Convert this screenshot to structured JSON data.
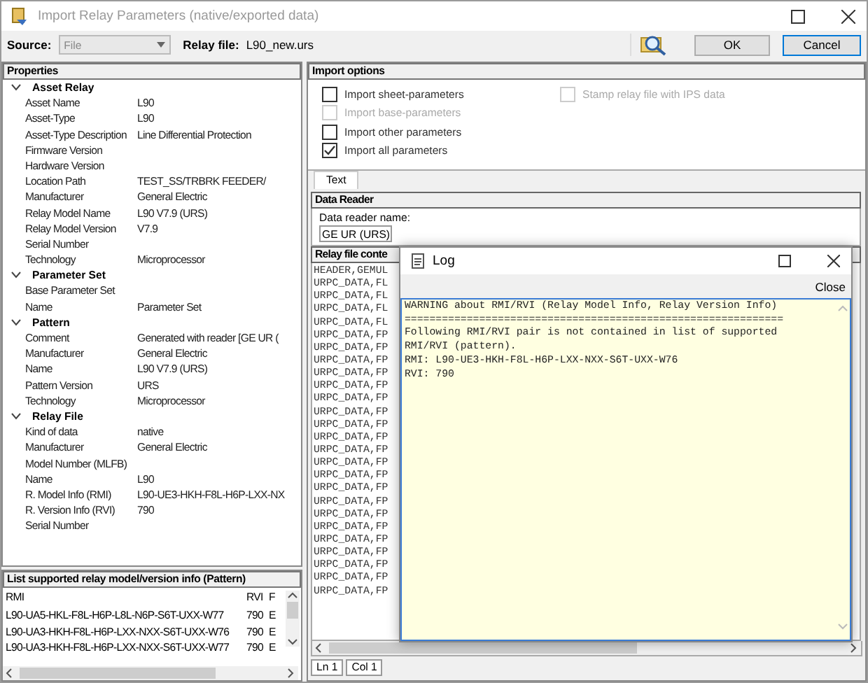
{
  "window": {
    "title": "Import Relay Parameters (native/exported data)"
  },
  "toolbar": {
    "source_label": "Source:",
    "source_value": "File",
    "relay_file_label": "Relay file:",
    "relay_file_value": "L90_new.urs",
    "buttons": [
      {
        "label": "OK",
        "selected": false
      },
      {
        "label": "Cancel",
        "selected": true
      }
    ]
  },
  "properties": {
    "title": "Properties",
    "groups": [
      {
        "name": "Asset Relay",
        "expanded": true,
        "rows": [
          {
            "name": "Asset Name",
            "value": "L90"
          },
          {
            "name": "Asset-Type",
            "value": "L90"
          },
          {
            "name": "Asset-Type Description",
            "value": "Line Differential Protection"
          },
          {
            "name": "Firmware Version"
          },
          {
            "name": "Hardware Version"
          },
          {
            "name": "Location Path",
            "value": "TEST_SS/TRBRK FEEDER/"
          },
          {
            "name": "Manufacturer",
            "value": "General Electric"
          },
          {
            "name": "Relay Model Name",
            "value": "L90   V7.9 (URS)"
          },
          {
            "name": "Relay Model Version",
            "value": "V7.9"
          },
          {
            "name": "Serial Number"
          },
          {
            "name": "Technology",
            "value": "Microprocessor"
          }
        ]
      },
      {
        "name": "Parameter Set",
        "expanded": true,
        "rows": [
          {
            "name": "Base Parameter Set"
          },
          {
            "name": "Name",
            "value": "Parameter Set"
          }
        ]
      },
      {
        "name": "Pattern",
        "expanded": true,
        "rows": [
          {
            "name": "Comment",
            "value": "Generated with reader [GE UR ("
          },
          {
            "name": "Manufacturer",
            "value": "General Electric"
          },
          {
            "name": "Name",
            "value": "L90   V7.9 (URS)"
          },
          {
            "name": "Pattern Version",
            "value": "URS"
          },
          {
            "name": "Technology",
            "value": "Microprocessor"
          }
        ]
      },
      {
        "name": "Relay File",
        "expanded": true,
        "rows": [
          {
            "name": "Kind of data",
            "value": "native"
          },
          {
            "name": "Manufacturer",
            "value": "General Electric"
          },
          {
            "name": "Model Number (MLFB)"
          },
          {
            "name": "Name",
            "value": "L90"
          },
          {
            "name": "R. Model Info (RMI)",
            "value": "L90-UE3-HKH-F8L-H6P-LXX-NX"
          },
          {
            "name": "R. Version Info (RVI)",
            "value": "790"
          },
          {
            "name": "Serial Number"
          }
        ]
      }
    ]
  },
  "pattern_list": {
    "title": "List supported relay model/version info (Pattern)",
    "columns": [
      "RMI",
      "RVI",
      "F"
    ],
    "rows": [
      [
        "L90-UA5-HKL-F8L-H6P-L8L-N6P-S6T-UXX-W77",
        "790",
        "E"
      ],
      [
        "L90-UA3-HKH-F8L-H6P-LXX-NXX-S6T-UXX-W76",
        "790",
        "E"
      ],
      [
        "L90-UA3-HKH-F8L-H6P-LXX-NXX-S6T-UXX-W77",
        "790",
        "E"
      ]
    ]
  },
  "import_options": {
    "title": "Import options",
    "options": [
      {
        "label": "Import sheet-parameters",
        "checked": false,
        "disabled": false
      },
      {
        "label": "Import base-parameters",
        "checked": false,
        "disabled": true
      },
      {
        "label": "Import other parameters",
        "checked": false,
        "disabled": false
      },
      {
        "label": "Import all parameters",
        "checked": true,
        "disabled": false
      }
    ],
    "stamp": {
      "label": "Stamp relay file with IPS data",
      "checked": false,
      "disabled": true
    }
  },
  "tabs": [
    {
      "label": "Text",
      "selected": true
    }
  ],
  "data_reader": {
    "title": "Data Reader",
    "field_label": "Data reader name:",
    "value": "GE UR (URS)"
  },
  "relay_file_contents": {
    "title": "Relay file conte",
    "lines": [
      "HEADER,GEMUL",
      "URPC_DATA,FL",
      "URPC_DATA,FL",
      "URPC_DATA,FL",
      "URPC_DATA,FL",
      "URPC_DATA,FP",
      "URPC_DATA,FP",
      "URPC_DATA,FP",
      "URPC_DATA,FP",
      "URPC_DATA,FP",
      "URPC_DATA,FP",
      "URPC_DATA,FP",
      "URPC_DATA,FP",
      "URPC_DATA,FP",
      "URPC_DATA,FP",
      "URPC_DATA,FP",
      "URPC_DATA,FP",
      "URPC_DATA,FP",
      "URPC_DATA,FP",
      "URPC_DATA,FP",
      "URPC_DATA,FP",
      "URPC_DATA,FP",
      "URPC_DATA,FP",
      "URPC_DATA,FP",
      "URPC_DATA,FP",
      "URPC_DATA,FP"
    ]
  },
  "status_bar": [
    "Ln 1",
    "Col 1"
  ],
  "log_window": {
    "title": "Log",
    "close_label": "Close",
    "lines": [
      "WARNING about RMI/RVI (Relay Model Info, Relay Version Info)",
      "=============================================================",
      "Following RMI/RVI pair is not contained in list of supported",
      "RMI/RVI (pattern).",
      "RMI: L90-UE3-HKH-F8L-H6P-LXX-NXX-S6T-UXX-W76",
      "RVI: 790"
    ]
  }
}
